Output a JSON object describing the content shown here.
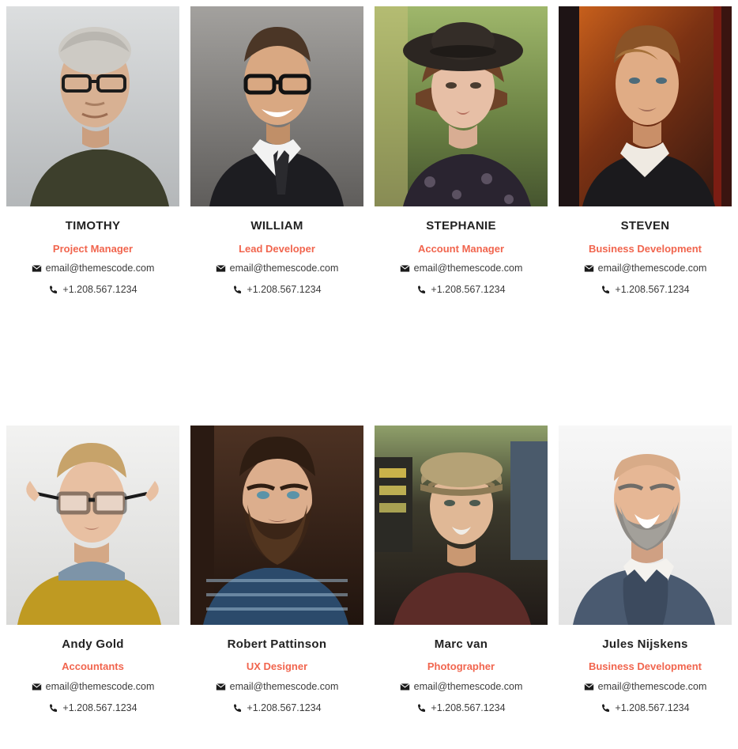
{
  "page": {
    "background": "#ffffff",
    "accent_color": "#f1654e",
    "name_color": "#222222",
    "contact_color": "#3b3b3b"
  },
  "icons": {
    "email": "envelope-icon",
    "phone": "phone-icon"
  },
  "team": {
    "rows": [
      {
        "members": [
          {
            "name": "TIMOTHY",
            "role": "Project Manager",
            "email": "email@themescode.com",
            "phone": "+1.208.567.1234",
            "photo": {
              "alt": "portrait-timothy",
              "bg_top": "#d7d9da",
              "bg_bottom": "#b9bcbe",
              "skin": "#d8b193",
              "hair": "#cdcac4",
              "clothing": "#3d3f2c",
              "accessory": "glasses"
            }
          },
          {
            "name": "WILLIAM",
            "role": "Lead Developer",
            "email": "email@themescode.com",
            "phone": "+1.208.567.1234",
            "photo": {
              "alt": "portrait-william",
              "bg_top": "#9a9895",
              "bg_bottom": "#6d6b69",
              "skin": "#d9a882",
              "hair": "#4b3626",
              "clothing": "#1d1d21",
              "accessory": "glasses"
            }
          },
          {
            "name": "STEPHANIE",
            "role": "Account Manager",
            "email": "email@themescode.com",
            "phone": "+1.208.567.1234",
            "photo": {
              "alt": "portrait-stephanie",
              "bg_top": "#8fa85e",
              "bg_bottom": "#4f5f3a",
              "skin": "#e7bfa6",
              "hair": "#6e4328",
              "clothing": "#2a2430",
              "accessory": "hat"
            }
          },
          {
            "name": "STEVEN",
            "role": "Business Development",
            "email": "email@themescode.com",
            "phone": "+1.208.567.1234",
            "photo": {
              "alt": "portrait-steven",
              "bg_top": "#b54a14",
              "bg_bottom": "#3c1b10",
              "skin": "#e0ac85",
              "hair": "#8a5327",
              "clothing": "#1b1a1d",
              "accessory": "none"
            }
          }
        ]
      },
      {
        "members": [
          {
            "name": "Andy Gold",
            "role": "Accountants",
            "email": "email@themescode.com",
            "phone": "+1.208.567.1234",
            "photo": {
              "alt": "portrait-andy-gold",
              "bg_top": "#f0f0ef",
              "bg_bottom": "#dcdcda",
              "skin": "#e8c0a2",
              "hair": "#c7a36a",
              "clothing": "#bf9a22",
              "accessory": "glasses"
            }
          },
          {
            "name": "Robert Pattinson",
            "role": "UX Designer",
            "email": "email@themescode.com",
            "phone": "+1.208.567.1234",
            "photo": {
              "alt": "portrait-robert-pattinson",
              "bg_top": "#432a1c",
              "bg_bottom": "#241610",
              "skin": "#dcae8d",
              "hair": "#2e1d12",
              "clothing": "#2b4a6b",
              "accessory": "beard"
            }
          },
          {
            "name": "Marc van",
            "role": "Photographer",
            "email": "email@themescode.com",
            "phone": "+1.208.567.1234",
            "photo": {
              "alt": "portrait-marc-van",
              "bg_top": "#6f7a55",
              "bg_bottom": "#231d1a",
              "skin": "#e0b896",
              "hair": "#a8966e",
              "clothing": "#5c2c28",
              "accessory": "cap"
            }
          },
          {
            "name": "Jules Nijskens",
            "role": "Business Development",
            "email": "email@themescode.com",
            "phone": "+1.208.567.1234",
            "photo": {
              "alt": "portrait-jules-nijskens",
              "bg_top": "#f5f5f5",
              "bg_bottom": "#e6e6e6",
              "skin": "#e6b795",
              "hair": "#8e8b86",
              "clothing": "#4a5a70",
              "accessory": "beard"
            }
          }
        ]
      }
    ]
  }
}
